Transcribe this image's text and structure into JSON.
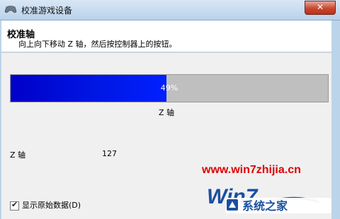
{
  "window": {
    "title": "校准游戏设备",
    "close_label": "✕"
  },
  "header": {
    "title": "校准轴",
    "description": "向上向下移动 Z 轴，然后按控制器上的按钮。"
  },
  "progress": {
    "value": 0.49,
    "label": "49%",
    "caption": "Z 轴",
    "fill_color": "#0010e0",
    "track_color": "#bfbfbf"
  },
  "axis_value": {
    "label": "Z 轴",
    "value": "127"
  },
  "checkbox": {
    "label": "显示原始数据(D)",
    "checked": true
  },
  "watermark": {
    "url": "www.win7zhijia.cn",
    "brand": "系统之家",
    "logo_text": "Win7"
  }
}
